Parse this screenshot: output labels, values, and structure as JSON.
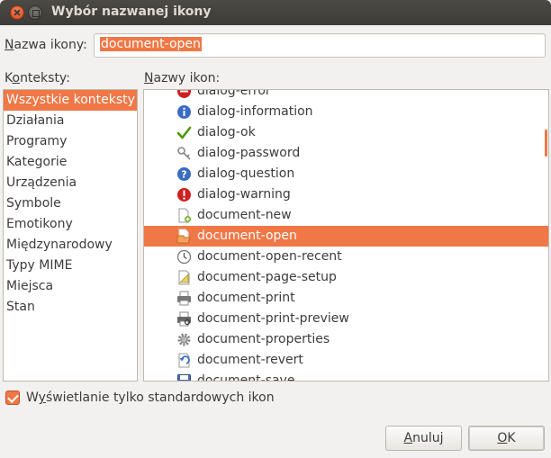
{
  "window": {
    "title": "Wybór nazwanej ikony"
  },
  "name_field": {
    "label_underlined": "N",
    "label_rest": "azwa ikony:",
    "value": "document-open"
  },
  "contexts": {
    "label_prefix": "K",
    "label_underlined": "o",
    "label_rest": "nteksty:",
    "items": [
      {
        "label": "Wszystkie konteksty",
        "selected": true
      },
      {
        "label": "Działania"
      },
      {
        "label": "Programy"
      },
      {
        "label": "Kategorie"
      },
      {
        "label": "Urządzenia"
      },
      {
        "label": "Symbole"
      },
      {
        "label": "Emotikony"
      },
      {
        "label": "Międzynarodowy"
      },
      {
        "label": "Typy MIME"
      },
      {
        "label": "Miejsca"
      },
      {
        "label": "Stan"
      }
    ]
  },
  "icons": {
    "label_underlined": "N",
    "label_rest": "azwy ikon:",
    "items": [
      {
        "name": "dialog-error",
        "icon": "error-icon"
      },
      {
        "name": "dialog-information",
        "icon": "info-icon"
      },
      {
        "name": "dialog-ok",
        "icon": "checkmark-icon"
      },
      {
        "name": "dialog-password",
        "icon": "key-icon"
      },
      {
        "name": "dialog-question",
        "icon": "question-icon"
      },
      {
        "name": "dialog-warning",
        "icon": "warning-icon"
      },
      {
        "name": "document-new",
        "icon": "new-document-icon"
      },
      {
        "name": "document-open",
        "icon": "open-document-icon",
        "selected": true
      },
      {
        "name": "document-open-recent",
        "icon": "clock-icon"
      },
      {
        "name": "document-page-setup",
        "icon": "page-setup-icon"
      },
      {
        "name": "document-print",
        "icon": "printer-icon"
      },
      {
        "name": "document-print-preview",
        "icon": "print-preview-icon"
      },
      {
        "name": "document-properties",
        "icon": "gear-icon"
      },
      {
        "name": "document-revert",
        "icon": "revert-icon"
      },
      {
        "name": "document-save",
        "icon": "save-icon"
      }
    ]
  },
  "checkbox": {
    "label_prefix": "W",
    "label_underlined": "y",
    "label_rest": "świetlanie tylko standardowych ikon",
    "checked": true
  },
  "buttons": {
    "cancel_underlined": "A",
    "cancel_rest": "nuluj",
    "ok_underlined": "O",
    "ok_rest": "K"
  },
  "colors": {
    "accent": "#f07746",
    "titlebar": "#3c3b37",
    "background": "#f2f1f0"
  }
}
